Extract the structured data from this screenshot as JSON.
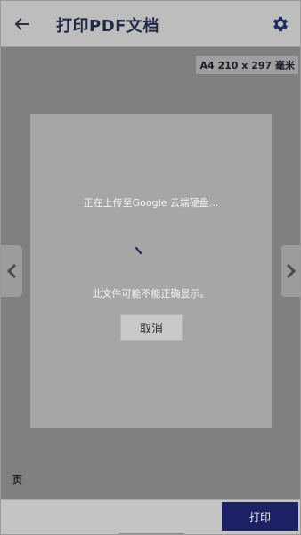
{
  "header": {
    "back_icon": "arrow-left-icon",
    "title": "打印PDF文档",
    "settings_icon": "gear-icon",
    "accent_color": "#232a48"
  },
  "preview": {
    "paper_size": "A4 210 x 297 毫米",
    "upload_status": "正在上传至Google 云端硬盘...",
    "warning": "此文件可能不能正确显示。",
    "cancel_label": "取消",
    "prev_icon": "chevron-left-icon",
    "next_icon": "chevron-right-icon"
  },
  "footer": {
    "pages_label": "页",
    "print_label": "打印",
    "print_button_color": "#1c2166"
  }
}
